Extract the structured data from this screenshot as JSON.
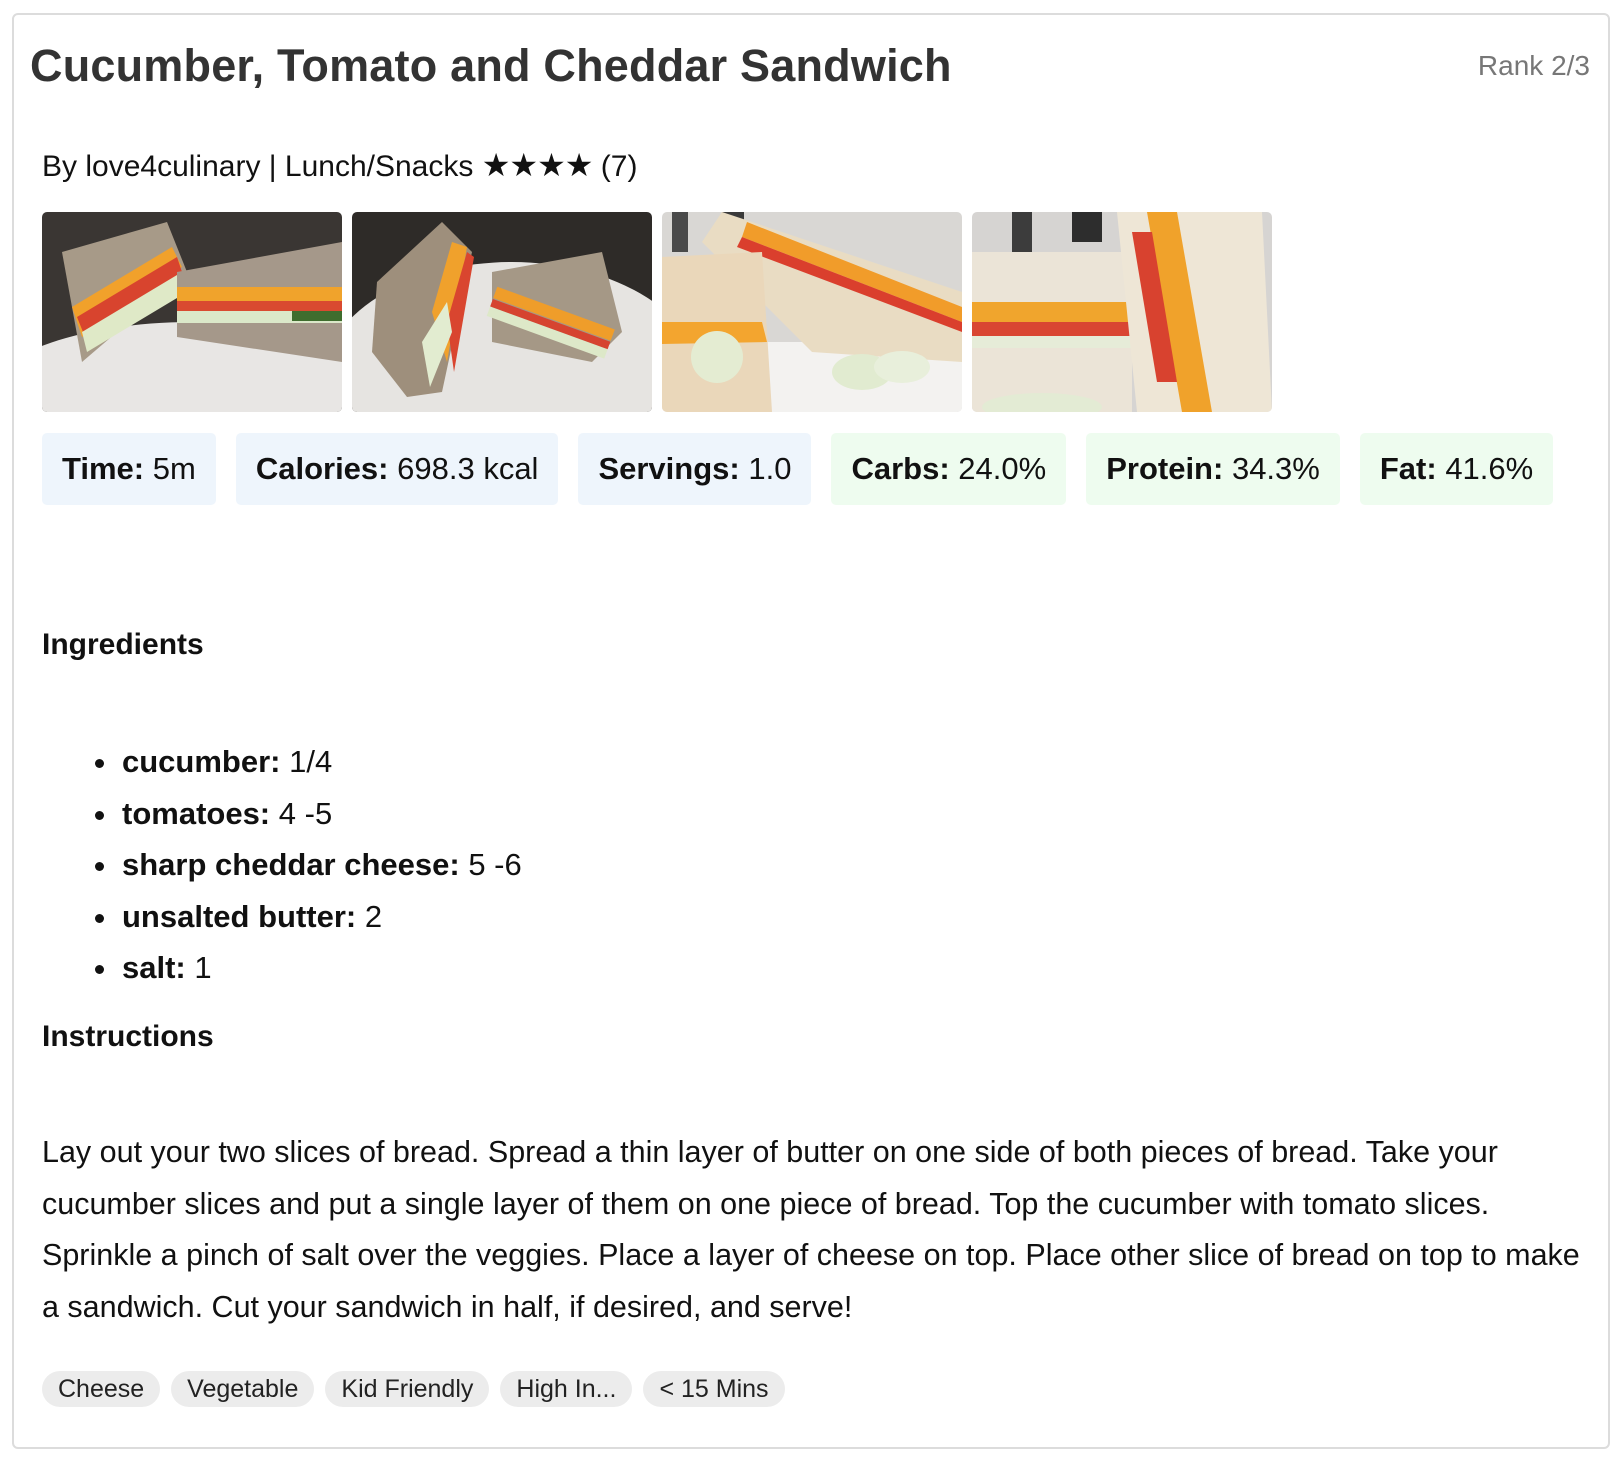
{
  "recipe": {
    "title": "Cucumber, Tomato and Cheddar Sandwich",
    "rank": "Rank 2/3",
    "author_line": "By love4culinary | Lunch/Snacks",
    "stars": "★★★★",
    "rating_count": "(7)",
    "rating_value": 4
  },
  "stats": [
    {
      "label": "Time:",
      "value": "5m",
      "tone": "blue"
    },
    {
      "label": "Calories:",
      "value": "698.3 kcal",
      "tone": "blue"
    },
    {
      "label": "Servings:",
      "value": "1.0",
      "tone": "blue"
    },
    {
      "label": "Carbs:",
      "value": "24.0%",
      "tone": "green"
    },
    {
      "label": "Protein:",
      "value": "34.3%",
      "tone": "green"
    },
    {
      "label": "Fat:",
      "value": "41.6%",
      "tone": "green"
    }
  ],
  "ingredients_heading": "Ingredients",
  "ingredients": [
    {
      "name": "cucumber:",
      "amount": "1/4"
    },
    {
      "name": "tomatoes:",
      "amount": "4 -5"
    },
    {
      "name": "sharp cheddar cheese:",
      "amount": "5 -6"
    },
    {
      "name": "unsalted butter:",
      "amount": "2"
    },
    {
      "name": "salt:",
      "amount": "1"
    }
  ],
  "instructions_heading": "Instructions",
  "instructions_text": "Lay out your two slices of bread. Spread a thin layer of butter on one side of both pieces of bread. Take your cucumber slices and put a single layer of them on one piece of bread. Top the cucumber with tomato slices. Sprinkle a pinch of salt over the veggies. Place a layer of cheese on top. Place other slice of bread on top to make a sandwich. Cut your sandwich in half, if desired, and serve!",
  "tags": [
    "Cheese",
    "Vegetable",
    "Kid Friendly",
    "High In...",
    "< 15 Mins"
  ],
  "colors": {
    "stat_blue_bg": "#eef5fc",
    "stat_green_bg": "#eefcef",
    "tag_bg": "#ececec",
    "title_color": "#333333",
    "rank_color": "#777777"
  }
}
